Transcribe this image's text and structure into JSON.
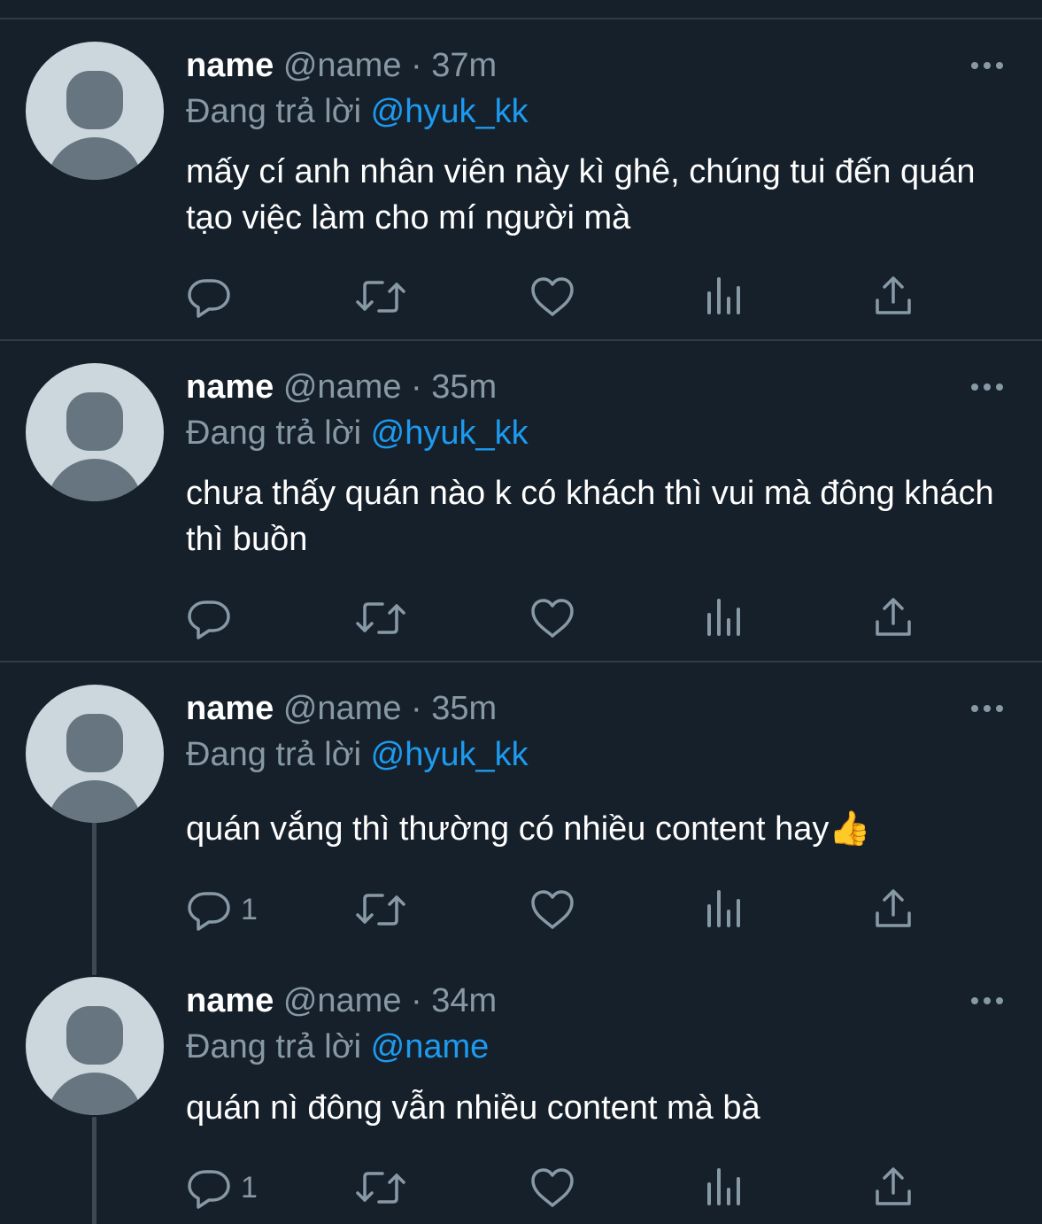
{
  "colors": {
    "background": "#16202b",
    "divider": "#2f3b47",
    "muted": "#8899a6",
    "mention": "#1d9bf0",
    "avatar_bg": "#ccd6dd",
    "avatar_fg": "#66757f"
  },
  "tweets": [
    {
      "name": "name",
      "handle": "@name",
      "separator": "·",
      "time": "37m",
      "reply_prefix": "Đang trả lời",
      "reply_to": "@hyuk_kk",
      "text": "mấy cí anh nhân viên này kì ghê, chúng tui đến quán tạo việc làm cho mí người mà",
      "reply_count": ""
    },
    {
      "name": "name",
      "handle": "@name",
      "separator": "·",
      "time": "35m",
      "reply_prefix": "Đang trả lời",
      "reply_to": "@hyuk_kk",
      "text": "chưa thấy quán nào k có khách thì vui mà đông khách thì buồn",
      "reply_count": ""
    },
    {
      "name": "name",
      "handle": "@name",
      "separator": "·",
      "time": "35m",
      "reply_prefix": "Đang trả lời",
      "reply_to": "@hyuk_kk",
      "text": "quán vắng thì thường có nhiều content hay👍",
      "reply_count": "1"
    },
    {
      "name": "name",
      "handle": "@name",
      "separator": "·",
      "time": "34m",
      "reply_prefix": "Đang trả lời",
      "reply_to": "@name",
      "text": "quán nì đông vẫn nhiều content mà bà",
      "reply_count": "1"
    }
  ],
  "icons": {
    "reply": "reply-icon",
    "retweet": "retweet-icon",
    "like": "heart-icon",
    "analytics": "analytics-icon",
    "share": "share-icon",
    "more": "more-icon"
  }
}
